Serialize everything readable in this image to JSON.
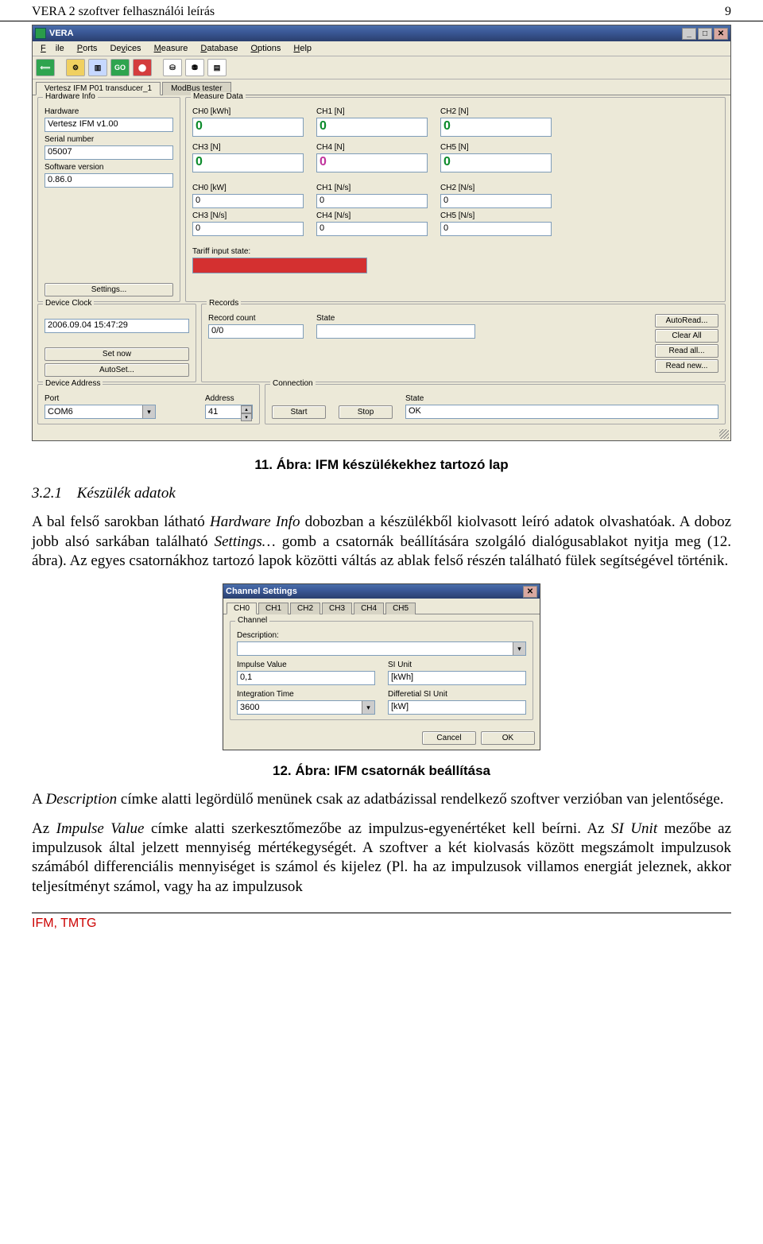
{
  "doc": {
    "header_left": "VERA 2 szoftver felhasználói leírás",
    "header_right": "9",
    "footer": "IFM, TMTG",
    "caption1": "11. Ábra: IFM készülékekhez tartozó lap",
    "sec_num": "3.2.1",
    "sec_title": "Készülék adatok",
    "para1a": "A bal felső sarokban látható ",
    "para1b": "Hardware Info",
    "para1c": " dobozban a készülékből kiolvasott leíró adatok olvashatóak. A doboz jobb alsó sarkában található ",
    "para1d": "Settings…",
    "para1e": " gomb a csatornák beállítására szolgáló dialógusablakot nyitja meg (12. ábra). Az egyes csatornákhoz tartozó lapok közötti váltás az ablak felső részén található fülek segítségével történik.",
    "caption2": "12. Ábra: IFM csatornák beállítása",
    "para2a": "A ",
    "para2b": "Description",
    "para2c": " címke alatti legördülő menünek csak az adatbázissal rendelkező szoftver verzióban van jelentősége.",
    "para3a": "Az ",
    "para3b": "Impulse Value",
    "para3c": " címke alatti szerkesztőmezőbe az impulzus-egyenértéket kell beírni. Az ",
    "para3d": "SI Unit",
    "para3e": " mezőbe az impulzusok által jelzett mennyiség mértékegységét. A szoftver a két kiolvasás között megszámolt impulzusok számából differenciális mennyiséget is számol és kijelez (Pl. ha az impulzusok villamos energiát jeleznek, akkor teljesítményt számol, vagy ha az impulzusok"
  },
  "app": {
    "title": "VERA",
    "menus": [
      "File",
      "Ports",
      "Devices",
      "Measure",
      "Database",
      "Options",
      "Help"
    ],
    "tabs": [
      "Vertesz IFM P01 transducer_1",
      "ModBus tester"
    ],
    "active_tab": 0,
    "hw": {
      "group": "Hardware Info",
      "hardware_lbl": "Hardware",
      "hardware_val": "Vertesz IFM  v1.00",
      "serial_lbl": "Serial number",
      "serial_val": "05007",
      "sw_lbl": "Software version",
      "sw_val": "0.86.0",
      "settings_btn": "Settings..."
    },
    "meas": {
      "group": "Measure Data",
      "row1": [
        {
          "lbl": "CH0 [kWh]",
          "val": "0",
          "cls": "green"
        },
        {
          "lbl": "CH1 [N]",
          "val": "0",
          "cls": "green"
        },
        {
          "lbl": "CH2 [N]",
          "val": "0",
          "cls": "green"
        }
      ],
      "row2": [
        {
          "lbl": "CH3 [N]",
          "val": "0",
          "cls": "green"
        },
        {
          "lbl": "CH4 [N]",
          "val": "0",
          "cls": "red"
        },
        {
          "lbl": "CH5 [N]",
          "val": "0",
          "cls": "green"
        }
      ],
      "row3": [
        {
          "lbl": "CH0 [kW]",
          "val": "0"
        },
        {
          "lbl": "CH1 [N/s]",
          "val": "0"
        },
        {
          "lbl": "CH2 [N/s]",
          "val": "0"
        }
      ],
      "row4": [
        {
          "lbl": "CH3 [N/s]",
          "val": "0"
        },
        {
          "lbl": "CH4 [N/s]",
          "val": "0"
        },
        {
          "lbl": "CH5 [N/s]",
          "val": "0"
        }
      ],
      "tariff_lbl": "Tariff input state:"
    },
    "clock": {
      "group": "Device Clock",
      "val": "2006.09.04   15:47:29",
      "setnow": "Set now",
      "autoset": "AutoSet..."
    },
    "records": {
      "group": "Records",
      "count_lbl": "Record count",
      "count_val": "0/0",
      "state_lbl": "State",
      "btns": [
        "AutoRead...",
        "Clear All",
        "Read all...",
        "Read new..."
      ]
    },
    "addr": {
      "group": "Device Address",
      "port_lbl": "Port",
      "port_val": "COM6",
      "addr_lbl": "Address",
      "addr_val": "41"
    },
    "conn": {
      "group": "Connection",
      "start": "Start",
      "stop": "Stop",
      "state_lbl": "State",
      "state_val": "OK"
    }
  },
  "dialog": {
    "title": "Channel Settings",
    "tabs": [
      "CH0",
      "CH1",
      "CH2",
      "CH3",
      "CH4",
      "CH5"
    ],
    "active_tab": 0,
    "group": "Channel",
    "desc_lbl": "Description:",
    "imp_lbl": "Impulse Value",
    "imp_val": "0,1",
    "siunit_lbl": "SI Unit",
    "siunit_val": "[kWh]",
    "int_lbl": "Integration Time",
    "int_val": "3600",
    "diff_lbl": "Differetial SI Unit",
    "diff_val": "[kW]",
    "cancel": "Cancel",
    "ok": "OK"
  }
}
